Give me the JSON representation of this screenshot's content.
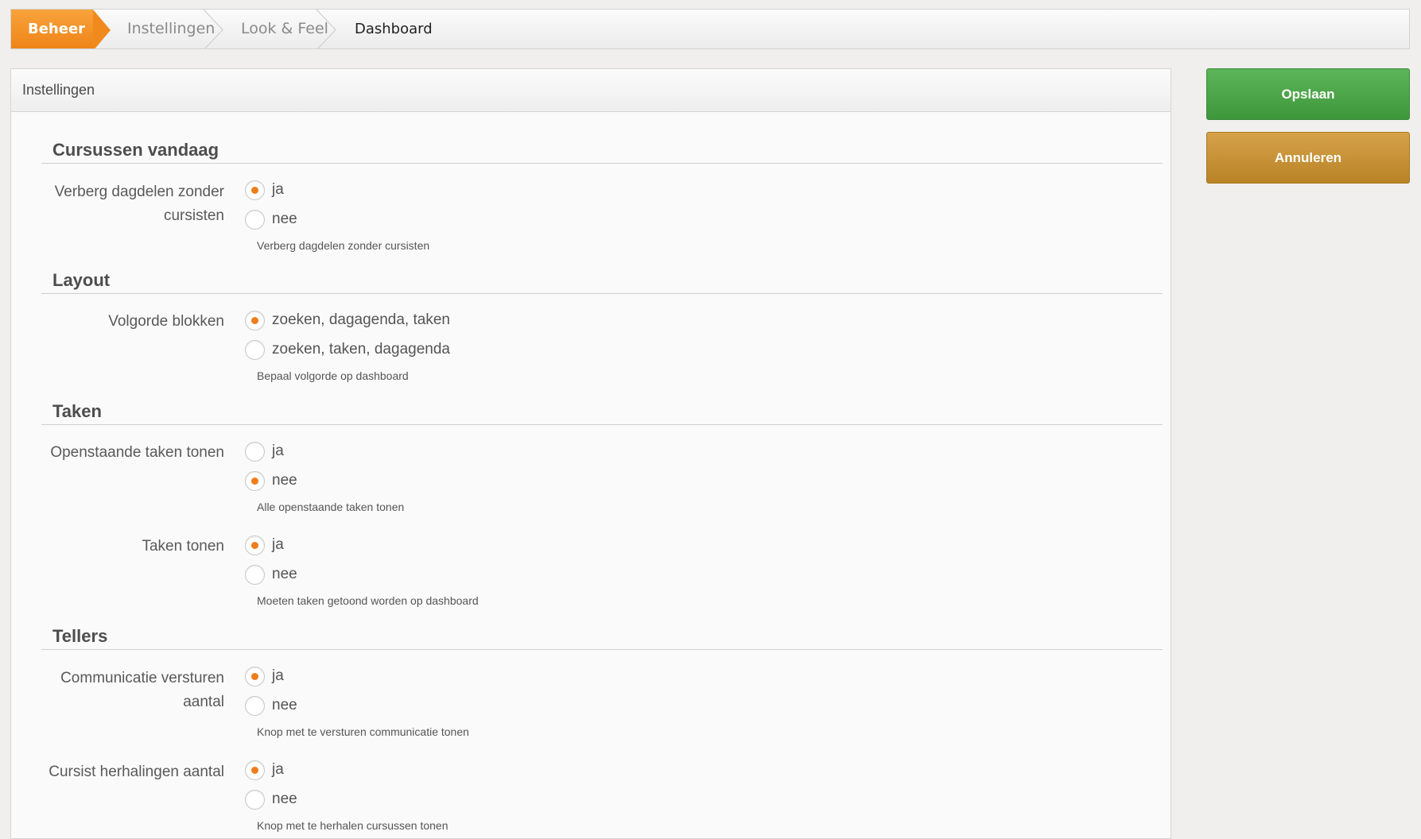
{
  "breadcrumb": {
    "items": [
      "Beheer",
      "Instellingen",
      "Look & Feel",
      "Dashboard"
    ]
  },
  "panel": {
    "title": "Instellingen"
  },
  "sections": {
    "cursussen": {
      "title": "Cursussen vandaag",
      "verberg": {
        "label": "Verberg dagdelen zonder cursisten",
        "options": [
          "ja",
          "nee"
        ],
        "selected": "ja",
        "help": "Verberg dagdelen zonder cursisten"
      }
    },
    "layout": {
      "title": "Layout",
      "volgorde": {
        "label": "Volgorde blokken",
        "options": [
          "zoeken, dagagenda, taken",
          "zoeken, taken, dagagenda"
        ],
        "selected": "zoeken, dagagenda, taken",
        "help": "Bepaal volgorde op dashboard"
      }
    },
    "taken": {
      "title": "Taken",
      "openstaande": {
        "label": "Openstaande taken tonen",
        "options": [
          "ja",
          "nee"
        ],
        "selected": "nee",
        "help": "Alle openstaande taken tonen"
      },
      "tonen": {
        "label": "Taken tonen",
        "options": [
          "ja",
          "nee"
        ],
        "selected": "ja",
        "help": "Moeten taken getoond worden op dashboard"
      }
    },
    "tellers": {
      "title": "Tellers",
      "communicatie": {
        "label": "Communicatie versturen aantal",
        "options": [
          "ja",
          "nee"
        ],
        "selected": "ja",
        "help": "Knop met te versturen communicatie tonen"
      },
      "herhalingen": {
        "label": "Cursist herhalingen aantal",
        "options": [
          "ja",
          "nee"
        ],
        "selected": "ja",
        "help": "Knop met te herhalen cursussen tonen"
      }
    }
  },
  "actions": {
    "save_label": "Opslaan",
    "cancel_label": "Annuleren"
  },
  "colors": {
    "accent": "#ee7d1c",
    "save": "#4ca648",
    "cancel": "#c8922f"
  }
}
